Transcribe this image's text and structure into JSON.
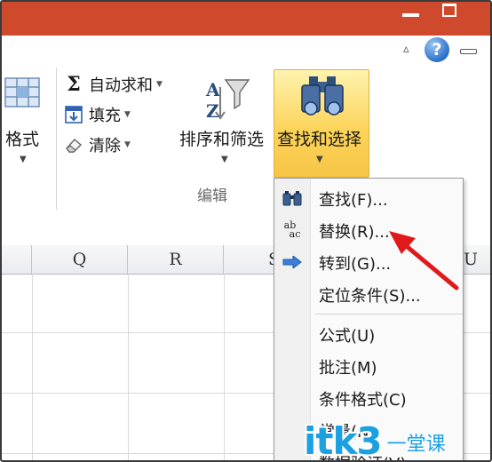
{
  "ribbon": {
    "format_label": "格式",
    "autosum_label": "自动求和",
    "fill_label": "填充",
    "clear_label": "清除",
    "sort_filter_label": "排序和筛选",
    "find_select_label": "查找和选择",
    "group_label": "编辑",
    "help_glyph": "?"
  },
  "columns": [
    "Q",
    "R",
    "S",
    "U"
  ],
  "menu": {
    "items": [
      {
        "label": "查找(F)...",
        "icon": "binoculars-icon"
      },
      {
        "label": "替换(R)...",
        "icon": "replace-abac-icon",
        "icon_text_top": "ab",
        "icon_text_bottom": "ac"
      },
      {
        "label": "转到(G)...",
        "icon": "arrow-right-icon"
      },
      {
        "label": "定位条件(S)...",
        "icon": ""
      },
      {
        "label": "公式(U)",
        "icon": ""
      },
      {
        "label": "批注(M)",
        "icon": ""
      },
      {
        "label": "条件格式(C)",
        "icon": ""
      },
      {
        "label": "常量(N)",
        "icon": ""
      },
      {
        "label": "数据验证(V)",
        "icon": ""
      }
    ]
  },
  "watermark": {
    "main": "itk3",
    "sub": "一堂课"
  },
  "colors": {
    "titlebar": "#cf4a2c",
    "highlight": "#fcd45b",
    "arrow": "#e0191b",
    "watermark": "#1ba1e2"
  }
}
